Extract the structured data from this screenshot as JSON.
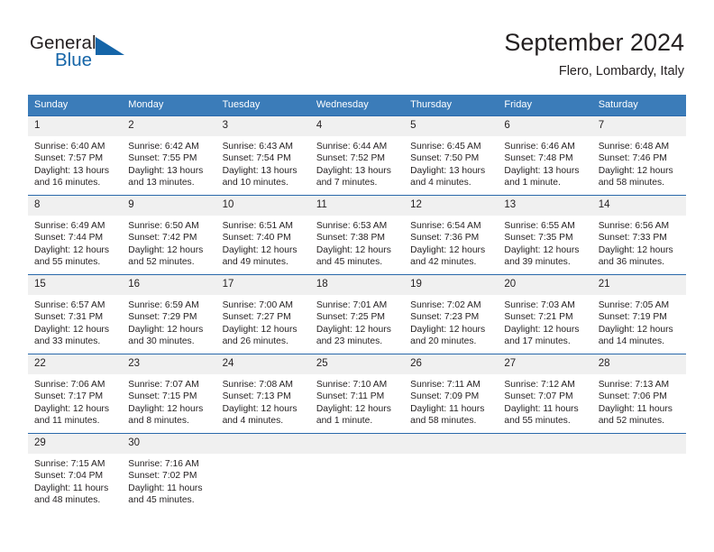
{
  "brand": {
    "name_part1": "General",
    "name_part2": "Blue",
    "color_dark": "#231f20",
    "color_blue": "#1565a8"
  },
  "header": {
    "title": "September 2024",
    "subtitle": "Flero, Lombardy, Italy"
  },
  "theme": {
    "header_bg": "#3b7cb9",
    "row_rule": "#2a69ab",
    "daynum_bg": "#f0f0f0",
    "text": "#231f20"
  },
  "calendar": {
    "weekday_headers": [
      "Sunday",
      "Monday",
      "Tuesday",
      "Wednesday",
      "Thursday",
      "Friday",
      "Saturday"
    ],
    "weeks": [
      [
        {
          "day": "1",
          "sunrise": "Sunrise: 6:40 AM",
          "sunset": "Sunset: 7:57 PM",
          "daylight_line1": "Daylight: 13 hours",
          "daylight_line2": "and 16 minutes."
        },
        {
          "day": "2",
          "sunrise": "Sunrise: 6:42 AM",
          "sunset": "Sunset: 7:55 PM",
          "daylight_line1": "Daylight: 13 hours",
          "daylight_line2": "and 13 minutes."
        },
        {
          "day": "3",
          "sunrise": "Sunrise: 6:43 AM",
          "sunset": "Sunset: 7:54 PM",
          "daylight_line1": "Daylight: 13 hours",
          "daylight_line2": "and 10 minutes."
        },
        {
          "day": "4",
          "sunrise": "Sunrise: 6:44 AM",
          "sunset": "Sunset: 7:52 PM",
          "daylight_line1": "Daylight: 13 hours",
          "daylight_line2": "and 7 minutes."
        },
        {
          "day": "5",
          "sunrise": "Sunrise: 6:45 AM",
          "sunset": "Sunset: 7:50 PM",
          "daylight_line1": "Daylight: 13 hours",
          "daylight_line2": "and 4 minutes."
        },
        {
          "day": "6",
          "sunrise": "Sunrise: 6:46 AM",
          "sunset": "Sunset: 7:48 PM",
          "daylight_line1": "Daylight: 13 hours",
          "daylight_line2": "and 1 minute."
        },
        {
          "day": "7",
          "sunrise": "Sunrise: 6:48 AM",
          "sunset": "Sunset: 7:46 PM",
          "daylight_line1": "Daylight: 12 hours",
          "daylight_line2": "and 58 minutes."
        }
      ],
      [
        {
          "day": "8",
          "sunrise": "Sunrise: 6:49 AM",
          "sunset": "Sunset: 7:44 PM",
          "daylight_line1": "Daylight: 12 hours",
          "daylight_line2": "and 55 minutes."
        },
        {
          "day": "9",
          "sunrise": "Sunrise: 6:50 AM",
          "sunset": "Sunset: 7:42 PM",
          "daylight_line1": "Daylight: 12 hours",
          "daylight_line2": "and 52 minutes."
        },
        {
          "day": "10",
          "sunrise": "Sunrise: 6:51 AM",
          "sunset": "Sunset: 7:40 PM",
          "daylight_line1": "Daylight: 12 hours",
          "daylight_line2": "and 49 minutes."
        },
        {
          "day": "11",
          "sunrise": "Sunrise: 6:53 AM",
          "sunset": "Sunset: 7:38 PM",
          "daylight_line1": "Daylight: 12 hours",
          "daylight_line2": "and 45 minutes."
        },
        {
          "day": "12",
          "sunrise": "Sunrise: 6:54 AM",
          "sunset": "Sunset: 7:36 PM",
          "daylight_line1": "Daylight: 12 hours",
          "daylight_line2": "and 42 minutes."
        },
        {
          "day": "13",
          "sunrise": "Sunrise: 6:55 AM",
          "sunset": "Sunset: 7:35 PM",
          "daylight_line1": "Daylight: 12 hours",
          "daylight_line2": "and 39 minutes."
        },
        {
          "day": "14",
          "sunrise": "Sunrise: 6:56 AM",
          "sunset": "Sunset: 7:33 PM",
          "daylight_line1": "Daylight: 12 hours",
          "daylight_line2": "and 36 minutes."
        }
      ],
      [
        {
          "day": "15",
          "sunrise": "Sunrise: 6:57 AM",
          "sunset": "Sunset: 7:31 PM",
          "daylight_line1": "Daylight: 12 hours",
          "daylight_line2": "and 33 minutes."
        },
        {
          "day": "16",
          "sunrise": "Sunrise: 6:59 AM",
          "sunset": "Sunset: 7:29 PM",
          "daylight_line1": "Daylight: 12 hours",
          "daylight_line2": "and 30 minutes."
        },
        {
          "day": "17",
          "sunrise": "Sunrise: 7:00 AM",
          "sunset": "Sunset: 7:27 PM",
          "daylight_line1": "Daylight: 12 hours",
          "daylight_line2": "and 26 minutes."
        },
        {
          "day": "18",
          "sunrise": "Sunrise: 7:01 AM",
          "sunset": "Sunset: 7:25 PM",
          "daylight_line1": "Daylight: 12 hours",
          "daylight_line2": "and 23 minutes."
        },
        {
          "day": "19",
          "sunrise": "Sunrise: 7:02 AM",
          "sunset": "Sunset: 7:23 PM",
          "daylight_line1": "Daylight: 12 hours",
          "daylight_line2": "and 20 minutes."
        },
        {
          "day": "20",
          "sunrise": "Sunrise: 7:03 AM",
          "sunset": "Sunset: 7:21 PM",
          "daylight_line1": "Daylight: 12 hours",
          "daylight_line2": "and 17 minutes."
        },
        {
          "day": "21",
          "sunrise": "Sunrise: 7:05 AM",
          "sunset": "Sunset: 7:19 PM",
          "daylight_line1": "Daylight: 12 hours",
          "daylight_line2": "and 14 minutes."
        }
      ],
      [
        {
          "day": "22",
          "sunrise": "Sunrise: 7:06 AM",
          "sunset": "Sunset: 7:17 PM",
          "daylight_line1": "Daylight: 12 hours",
          "daylight_line2": "and 11 minutes."
        },
        {
          "day": "23",
          "sunrise": "Sunrise: 7:07 AM",
          "sunset": "Sunset: 7:15 PM",
          "daylight_line1": "Daylight: 12 hours",
          "daylight_line2": "and 8 minutes."
        },
        {
          "day": "24",
          "sunrise": "Sunrise: 7:08 AM",
          "sunset": "Sunset: 7:13 PM",
          "daylight_line1": "Daylight: 12 hours",
          "daylight_line2": "and 4 minutes."
        },
        {
          "day": "25",
          "sunrise": "Sunrise: 7:10 AM",
          "sunset": "Sunset: 7:11 PM",
          "daylight_line1": "Daylight: 12 hours",
          "daylight_line2": "and 1 minute."
        },
        {
          "day": "26",
          "sunrise": "Sunrise: 7:11 AM",
          "sunset": "Sunset: 7:09 PM",
          "daylight_line1": "Daylight: 11 hours",
          "daylight_line2": "and 58 minutes."
        },
        {
          "day": "27",
          "sunrise": "Sunrise: 7:12 AM",
          "sunset": "Sunset: 7:07 PM",
          "daylight_line1": "Daylight: 11 hours",
          "daylight_line2": "and 55 minutes."
        },
        {
          "day": "28",
          "sunrise": "Sunrise: 7:13 AM",
          "sunset": "Sunset: 7:06 PM",
          "daylight_line1": "Daylight: 11 hours",
          "daylight_line2": "and 52 minutes."
        }
      ],
      [
        {
          "day": "29",
          "sunrise": "Sunrise: 7:15 AM",
          "sunset": "Sunset: 7:04 PM",
          "daylight_line1": "Daylight: 11 hours",
          "daylight_line2": "and 48 minutes."
        },
        {
          "day": "30",
          "sunrise": "Sunrise: 7:16 AM",
          "sunset": "Sunset: 7:02 PM",
          "daylight_line1": "Daylight: 11 hours",
          "daylight_line2": "and 45 minutes."
        },
        {
          "day": "",
          "sunrise": "",
          "sunset": "",
          "daylight_line1": "",
          "daylight_line2": ""
        },
        {
          "day": "",
          "sunrise": "",
          "sunset": "",
          "daylight_line1": "",
          "daylight_line2": ""
        },
        {
          "day": "",
          "sunrise": "",
          "sunset": "",
          "daylight_line1": "",
          "daylight_line2": ""
        },
        {
          "day": "",
          "sunrise": "",
          "sunset": "",
          "daylight_line1": "",
          "daylight_line2": ""
        },
        {
          "day": "",
          "sunrise": "",
          "sunset": "",
          "daylight_line1": "",
          "daylight_line2": ""
        }
      ]
    ]
  }
}
